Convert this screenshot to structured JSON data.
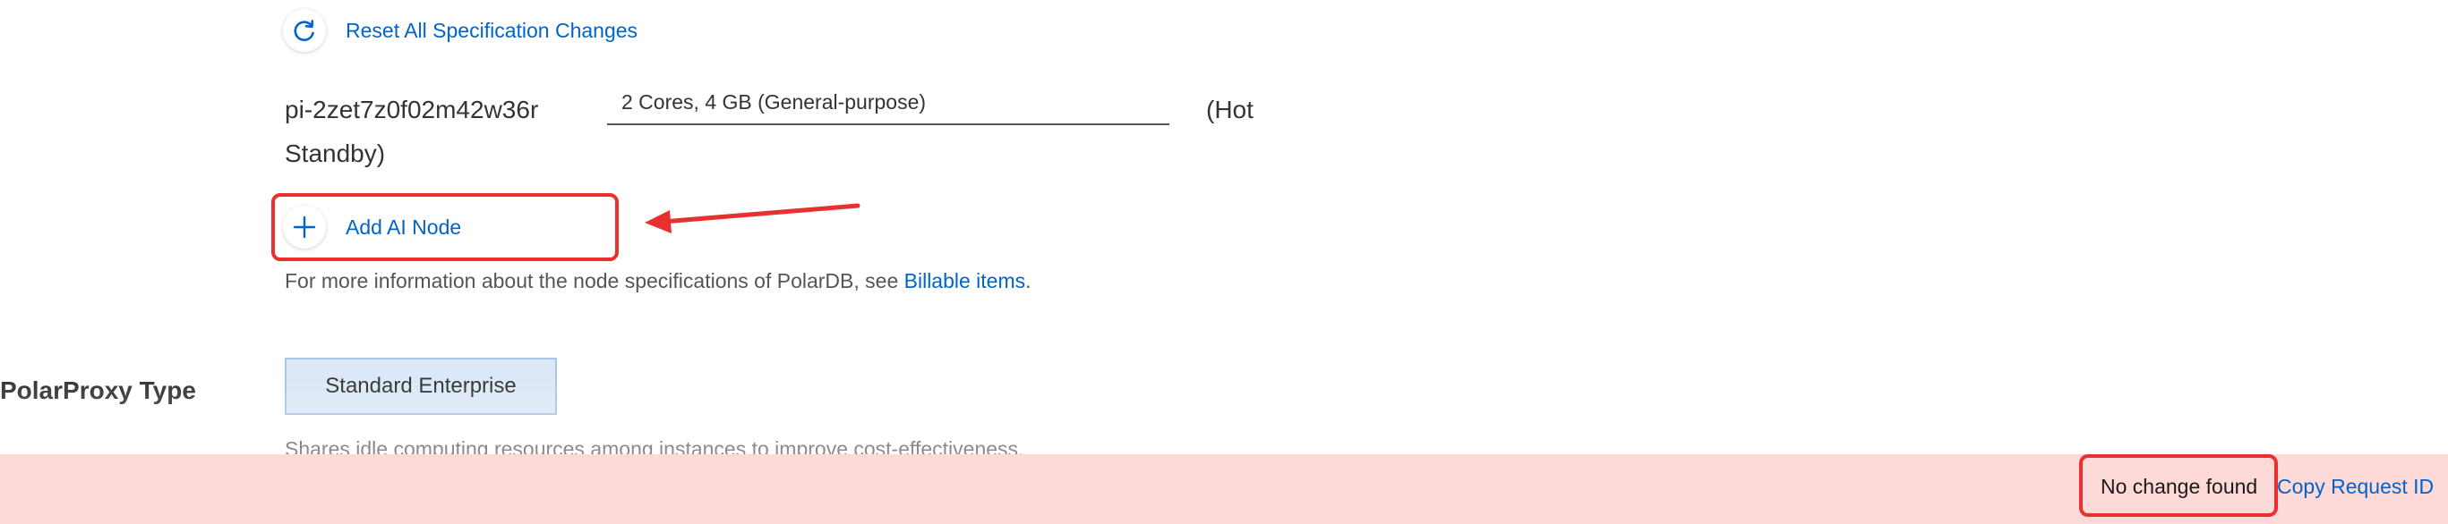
{
  "spec_section": {
    "reset_label": "Reset All Specification Changes",
    "reset_icon": "refresh-icon",
    "node": {
      "id": "pi-2zet7z0f02m42w36r",
      "spec_value": "2 Cores, 4 GB (General-purpose)",
      "role_part1": "(Hot",
      "role_part2": "Standby)"
    },
    "add_ai_node_label": "Add AI Node",
    "add_icon": "plus-icon",
    "info_prefix": "For more information about the node specifications of PolarDB, see ",
    "info_link": "Billable items",
    "info_suffix": "."
  },
  "proxy_section": {
    "label": "PolarProxy Type",
    "selected_option": "Standard Enterprise",
    "description": "Shares idle computing resources among instances to improve cost-effectiveness."
  },
  "error_bar": {
    "message": "No change found",
    "copy_request_id": "Copy Request ID"
  },
  "annotations": {
    "highlight_color": "#e8312f",
    "arrow_color": "#e8312f"
  },
  "colors": {
    "link": "#0064c8",
    "error_background": "#fdd9d7",
    "selected_option_background": "#dce8f7"
  }
}
